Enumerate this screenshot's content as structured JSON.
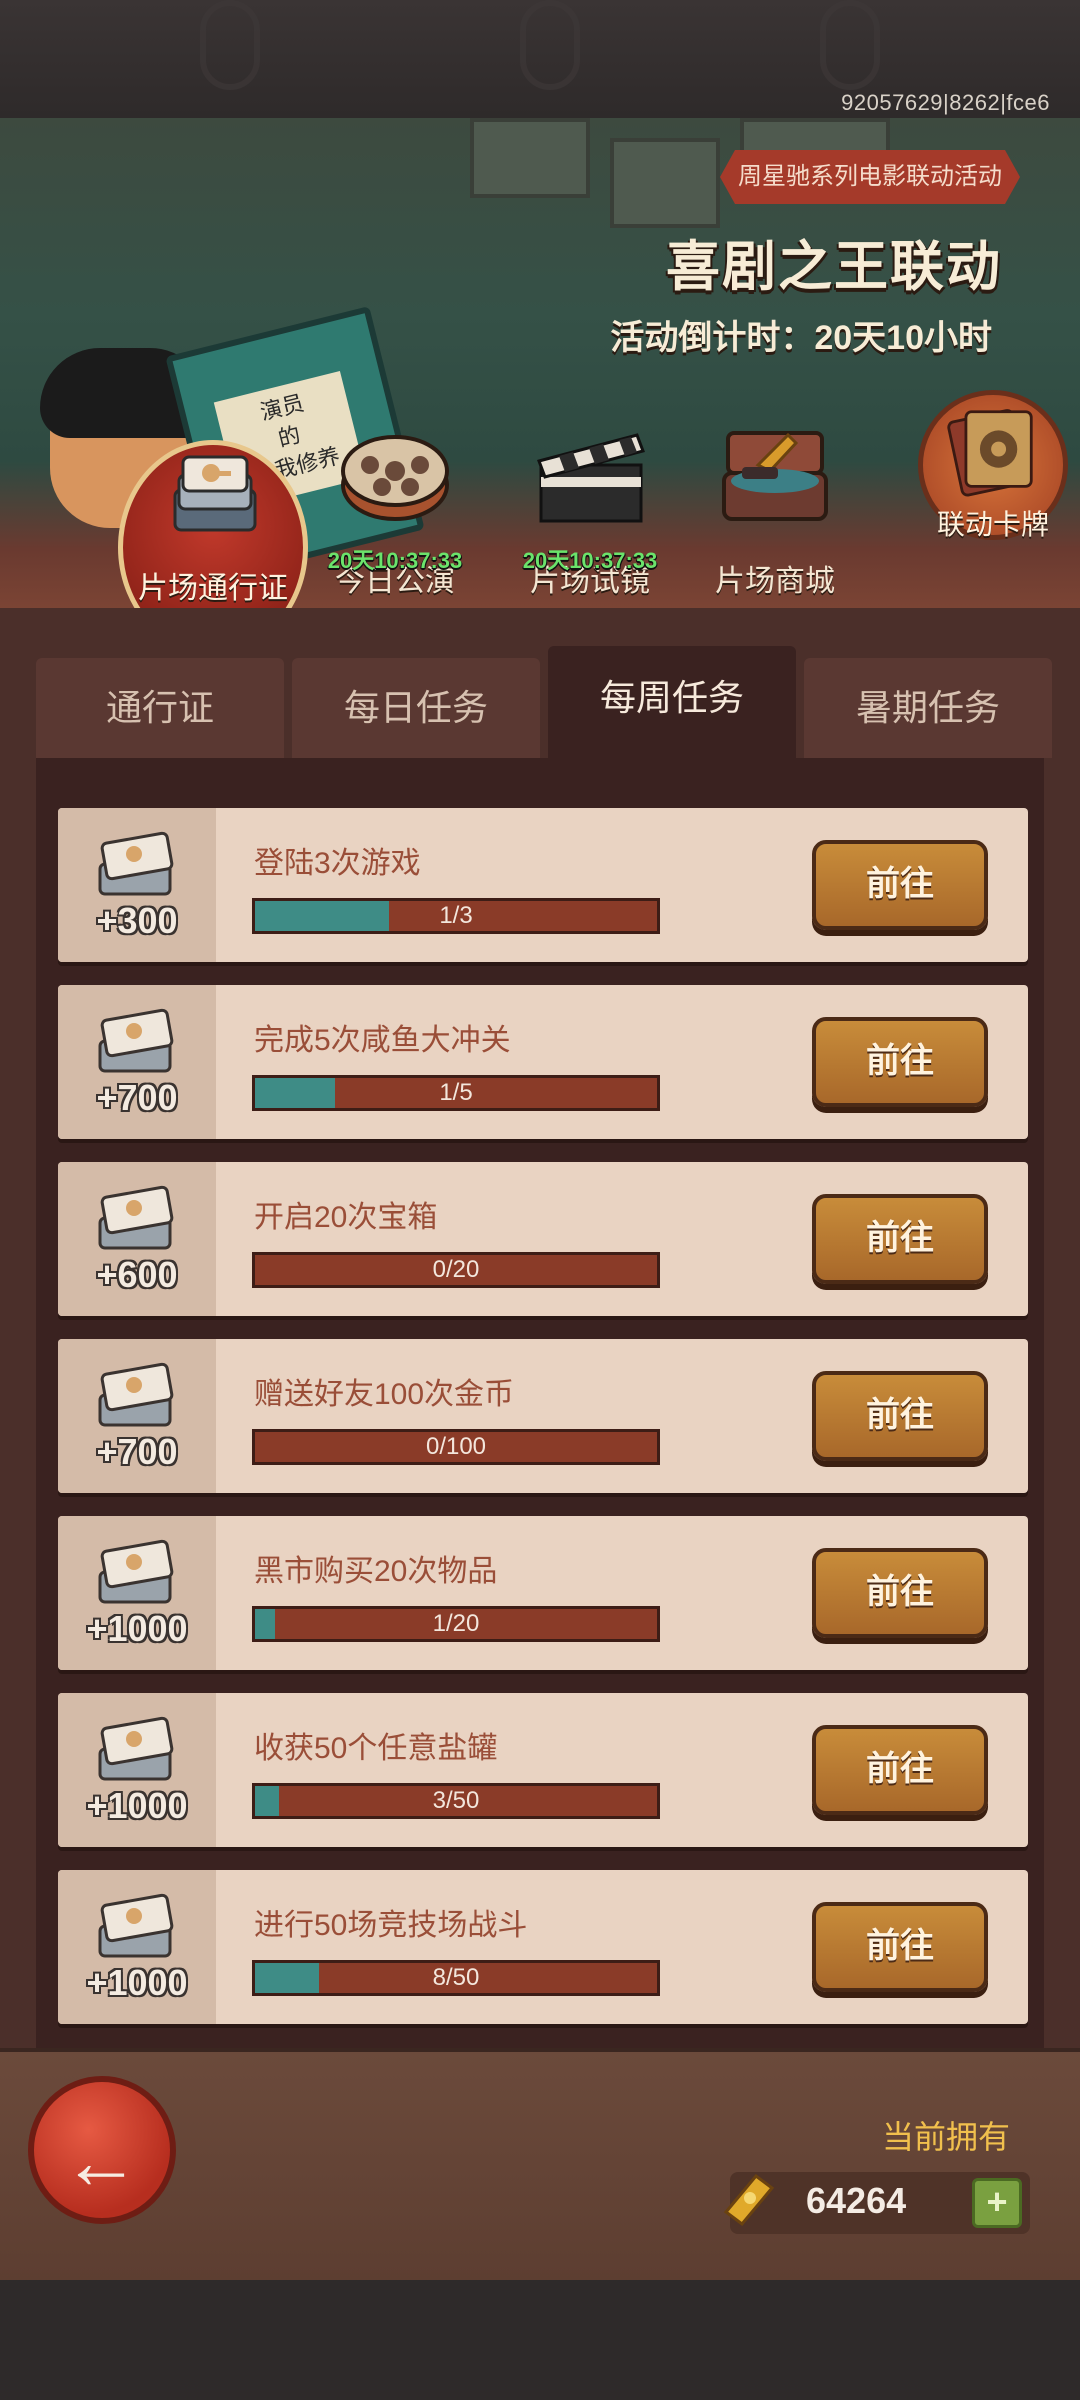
{
  "header": {
    "uid": "92057629|8262|fce6"
  },
  "banner": {
    "ribbon": "周星驰系列电影联动活动",
    "title": "喜剧之王联动",
    "countdown": "活动倒计时：20天10小时",
    "book_text": "演员\n的\n自我修养"
  },
  "nav": {
    "items": [
      {
        "label": "片场通行证",
        "timer": ""
      },
      {
        "label": "今日公演",
        "timer": "20天10:37:33"
      },
      {
        "label": "片场试镜",
        "timer": "20天10:37:33"
      },
      {
        "label": "片场商城",
        "timer": ""
      }
    ],
    "card_button": "联动卡牌"
  },
  "tabs": [
    {
      "label": "通行证"
    },
    {
      "label": "每日任务"
    },
    {
      "label": "每周任务"
    },
    {
      "label": "暑期任务"
    }
  ],
  "tasks": [
    {
      "reward": "+300",
      "title": "登陆3次游戏",
      "progress": "1/3",
      "fraction": 0.333,
      "button": "前往"
    },
    {
      "reward": "+700",
      "title": "完成5次咸鱼大冲关",
      "progress": "1/5",
      "fraction": 0.2,
      "button": "前往"
    },
    {
      "reward": "+600",
      "title": "开启20次宝箱",
      "progress": "0/20",
      "fraction": 0,
      "button": "前往"
    },
    {
      "reward": "+700",
      "title": "赠送好友100次金币",
      "progress": "0/100",
      "fraction": 0,
      "button": "前往"
    },
    {
      "reward": "+1000",
      "title": "黑市购买20次物品",
      "progress": "1/20",
      "fraction": 0.05,
      "button": "前往"
    },
    {
      "reward": "+1000",
      "title": "收获50个任意盐罐",
      "progress": "3/50",
      "fraction": 0.06,
      "button": "前往"
    },
    {
      "reward": "+1000",
      "title": "进行50场竞技场战斗",
      "progress": "8/50",
      "fraction": 0.16,
      "button": "前往"
    }
  ],
  "footer": {
    "owned_label": "当前拥有",
    "owned_value": "64264",
    "plus": "+"
  },
  "colors": {
    "progress_fill": "#3e8c86",
    "progress_bg": "#8a3b28",
    "accent_gold": "#f1c04d"
  },
  "icons": [
    "ticket-icon",
    "film-reel-icon",
    "clapperboard-icon",
    "shop-chest-icon",
    "card-deck-icon",
    "back-arrow-icon",
    "gold-ticket-icon",
    "add-icon"
  ]
}
